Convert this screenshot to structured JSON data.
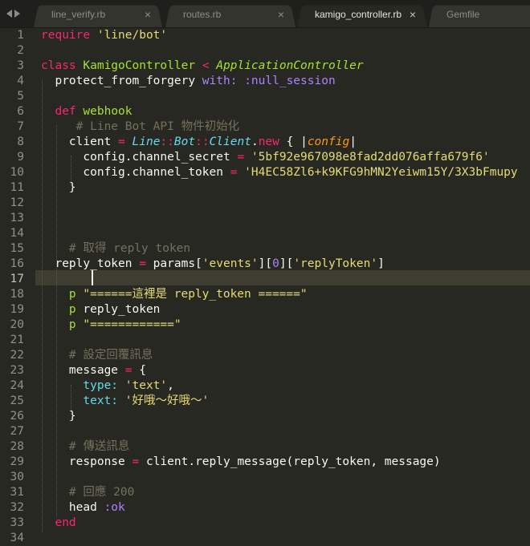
{
  "tabs": [
    {
      "name": "line_verify.rb",
      "active": false
    },
    {
      "name": "routes.rb",
      "active": false
    },
    {
      "name": "kamigo_controller.rb",
      "active": true
    },
    {
      "name": "Gemfile",
      "active": false
    }
  ],
  "close_glyph": "×",
  "editor": {
    "current_line": 17,
    "lines": [
      {
        "n": "1",
        "tokens": [
          [
            "kw",
            "require"
          ],
          [
            "plain",
            " "
          ],
          [
            "str",
            "'line/bot'"
          ]
        ]
      },
      {
        "n": "2",
        "tokens": []
      },
      {
        "n": "3",
        "tokens": [
          [
            "kw",
            "class"
          ],
          [
            "plain",
            " "
          ],
          [
            "cls",
            "KamigoController"
          ],
          [
            "plain",
            " "
          ],
          [
            "op",
            "<"
          ],
          [
            "plain",
            " "
          ],
          [
            "inh",
            "ApplicationController"
          ]
        ]
      },
      {
        "n": "4",
        "tokens": [
          [
            "plain",
            "  protect_from_forgery "
          ],
          [
            "sym",
            "with:"
          ],
          [
            "plain",
            " "
          ],
          [
            "sym",
            ":null_session"
          ]
        ]
      },
      {
        "n": "5",
        "tokens": []
      },
      {
        "n": "6",
        "tokens": [
          [
            "plain",
            "  "
          ],
          [
            "kw",
            "def"
          ],
          [
            "plain",
            " "
          ],
          [
            "fn",
            "webhook"
          ]
        ]
      },
      {
        "n": "7",
        "tokens": [
          [
            "plain",
            "     "
          ],
          [
            "com",
            "# Line Bot API 物件初始化"
          ]
        ]
      },
      {
        "n": "8",
        "tokens": [
          [
            "plain",
            "    client "
          ],
          [
            "op",
            "="
          ],
          [
            "plain",
            " "
          ],
          [
            "lib",
            "Line"
          ],
          [
            "op",
            "::"
          ],
          [
            "lib",
            "Bot"
          ],
          [
            "op",
            "::"
          ],
          [
            "lib",
            "Client"
          ],
          [
            "plain",
            "."
          ],
          [
            "kw",
            "new"
          ],
          [
            "plain",
            " { |"
          ],
          [
            "par",
            "config"
          ],
          [
            "plain",
            "|"
          ]
        ]
      },
      {
        "n": "9",
        "tokens": [
          [
            "plain",
            "      config.channel_secret "
          ],
          [
            "op",
            "="
          ],
          [
            "plain",
            " "
          ],
          [
            "str",
            "'5bf92e967098e8fad2dd076affa679f6'"
          ]
        ]
      },
      {
        "n": "10",
        "tokens": [
          [
            "plain",
            "      config.channel_token "
          ],
          [
            "op",
            "="
          ],
          [
            "plain",
            " "
          ],
          [
            "str",
            "'H4EC58Zl6+k9KFG9hMN2Yeiwm15Y/3X3bFmupy"
          ]
        ]
      },
      {
        "n": "11",
        "tokens": [
          [
            "plain",
            "    }"
          ]
        ]
      },
      {
        "n": "12",
        "tokens": []
      },
      {
        "n": "13",
        "tokens": []
      },
      {
        "n": "14",
        "tokens": []
      },
      {
        "n": "15",
        "tokens": [
          [
            "plain",
            "    "
          ],
          [
            "com",
            "# 取得 reply token"
          ]
        ]
      },
      {
        "n": "16",
        "tokens": [
          [
            "plain",
            "  reply_token "
          ],
          [
            "op",
            "="
          ],
          [
            "plain",
            " params["
          ],
          [
            "str",
            "'events'"
          ],
          [
            "plain",
            "]["
          ],
          [
            "num",
            "0"
          ],
          [
            "plain",
            "]["
          ],
          [
            "str",
            "'replyToken'"
          ],
          [
            "plain",
            "]"
          ]
        ]
      },
      {
        "n": "17",
        "tokens": []
      },
      {
        "n": "18",
        "tokens": [
          [
            "plain",
            "    "
          ],
          [
            "fn",
            "p"
          ],
          [
            "plain",
            " "
          ],
          [
            "str",
            "\"======這裡是 reply_token ======\""
          ]
        ]
      },
      {
        "n": "19",
        "tokens": [
          [
            "plain",
            "    "
          ],
          [
            "fn",
            "p"
          ],
          [
            "plain",
            " reply_token"
          ]
        ]
      },
      {
        "n": "20",
        "tokens": [
          [
            "plain",
            "    "
          ],
          [
            "fn",
            "p"
          ],
          [
            "plain",
            " "
          ],
          [
            "str",
            "\"============\""
          ]
        ]
      },
      {
        "n": "21",
        "tokens": []
      },
      {
        "n": "22",
        "tokens": [
          [
            "plain",
            "    "
          ],
          [
            "com",
            "# 設定回覆訊息"
          ]
        ]
      },
      {
        "n": "23",
        "tokens": [
          [
            "plain",
            "    message "
          ],
          [
            "op",
            "="
          ],
          [
            "plain",
            " {"
          ]
        ]
      },
      {
        "n": "24",
        "tokens": [
          [
            "plain",
            "      "
          ],
          [
            "key",
            "type:"
          ],
          [
            "plain",
            " "
          ],
          [
            "str",
            "'text'"
          ],
          [
            "plain",
            ","
          ]
        ]
      },
      {
        "n": "25",
        "tokens": [
          [
            "plain",
            "      "
          ],
          [
            "key",
            "text:"
          ],
          [
            "plain",
            " "
          ],
          [
            "str",
            "'好哦～好哦～'"
          ]
        ]
      },
      {
        "n": "26",
        "tokens": [
          [
            "plain",
            "    }"
          ]
        ]
      },
      {
        "n": "27",
        "tokens": []
      },
      {
        "n": "28",
        "tokens": [
          [
            "plain",
            "    "
          ],
          [
            "com",
            "# 傳送訊息"
          ]
        ]
      },
      {
        "n": "29",
        "tokens": [
          [
            "plain",
            "    response "
          ],
          [
            "op",
            "="
          ],
          [
            "plain",
            " client.reply_message(reply_token, message)"
          ]
        ]
      },
      {
        "n": "30",
        "tokens": []
      },
      {
        "n": "31",
        "tokens": [
          [
            "plain",
            "    "
          ],
          [
            "com",
            "# 回應 200"
          ]
        ]
      },
      {
        "n": "32",
        "tokens": [
          [
            "plain",
            "    head "
          ],
          [
            "sym",
            ":ok"
          ]
        ]
      },
      {
        "n": "33",
        "tokens": [
          [
            "plain",
            "  "
          ],
          [
            "kw",
            "end"
          ]
        ]
      },
      {
        "n": "34",
        "tokens": []
      }
    ]
  }
}
